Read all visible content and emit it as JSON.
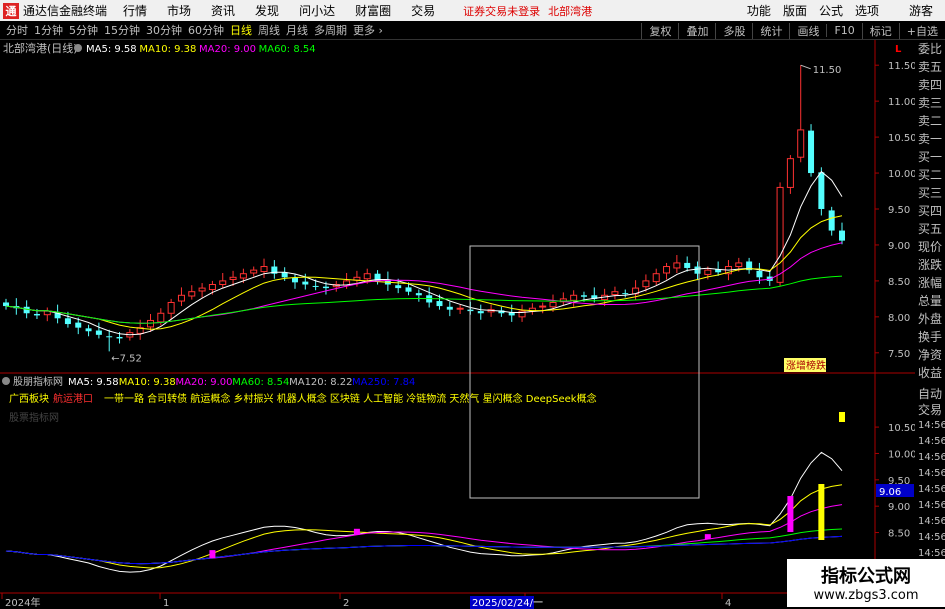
{
  "app": {
    "logo_glyph": "通",
    "title": "通达信金融终端",
    "menu": [
      "行情",
      "市场",
      "资讯",
      "发现",
      "问小达",
      "财富圈",
      "交易"
    ],
    "notice": "证券交易未登录",
    "notice_stock": "北部湾港",
    "right_menu": [
      "功能",
      "版面",
      "公式",
      "选项"
    ],
    "guest": "游客"
  },
  "periods": {
    "tabs": [
      "分时",
      "1分钟",
      "5分钟",
      "15分钟",
      "30分钟",
      "60分钟",
      "日线",
      "周线",
      "月线",
      "多周期",
      "更多"
    ],
    "active": "日线",
    "right_tools": [
      "复权",
      "叠加",
      "多股",
      "统计",
      "画线",
      "F10",
      "标记",
      "+自选"
    ]
  },
  "main_chart": {
    "stock_label": "北部湾港(日线)",
    "ma": [
      {
        "name": "MA5",
        "value": "9.58",
        "color": "#ffffff"
      },
      {
        "name": "MA10",
        "value": "9.38",
        "color": "#ffff00"
      },
      {
        "name": "MA20",
        "value": "9.00",
        "color": "#ff00ff"
      },
      {
        "name": "MA60",
        "value": "8.54",
        "color": "#00ff00"
      }
    ],
    "y_ticks": [
      "11.50",
      "11.00",
      "10.50",
      "10.00",
      "9.50",
      "9.00",
      "8.50",
      "8.00",
      "7.50"
    ],
    "ylim": [
      7.4,
      11.6
    ],
    "high_label": "11.50",
    "low_label": "7.52",
    "badge": "涨增榜跌",
    "corner_mark": "L"
  },
  "indicator": {
    "name": "股朋指标网",
    "ma": [
      {
        "name": "MA5",
        "value": "9.58",
        "color": "#ffffff"
      },
      {
        "name": "MA10",
        "value": "9.38",
        "color": "#ffff00"
      },
      {
        "name": "MA20",
        "value": "9.00",
        "color": "#ff00ff"
      },
      {
        "name": "MA60",
        "value": "8.54",
        "color": "#00ff00"
      },
      {
        "name": "MA120",
        "value": "8.22",
        "color": "#c0c0c0"
      },
      {
        "name": "MA250",
        "value": "7.84",
        "color": "#0000ff"
      }
    ],
    "sector_prefix": "广西板块",
    "sector_highlight": "航运港口",
    "concepts": "一带一路 合司转债 航运概念 乡村振兴 机器人概念 区块链 人工智能 冷链物流 天然气 星闪概念 DeepSeek概念",
    "subtitle": "股票指标网",
    "y_ticks": [
      "10.50",
      "10.00",
      "9.50",
      "9.00",
      "8.50"
    ],
    "current_tag": "9.06"
  },
  "x_axis": {
    "labels": [
      "2024年",
      "1",
      "2",
      "3",
      "4"
    ],
    "cursor_date": "2025/02/24/一"
  },
  "side_panel": {
    "top": [
      "委比",
      "卖五",
      "卖四",
      "卖三",
      "卖二",
      "卖一",
      "买一",
      "买二",
      "买三",
      "买四",
      "买五",
      "现价",
      "涨跌",
      "涨幅",
      "总量",
      "外盘",
      "换手",
      "净资",
      "收益"
    ],
    "bottom": [
      "自动",
      "交易",
      "14:56",
      "14:56",
      "14:56",
      "14:56",
      "14:56",
      "14:56",
      "14:56",
      "14:56",
      "14:56",
      "14:56"
    ]
  },
  "watermark": {
    "line1": "指标公式网",
    "line2": "www.zbgs3.com"
  },
  "chart_data": {
    "type": "candlestick",
    "closes": [
      8.15,
      8.12,
      8.05,
      8.02,
      8.08,
      7.98,
      7.9,
      7.85,
      7.8,
      7.75,
      7.72,
      7.7,
      7.78,
      7.85,
      7.95,
      8.05,
      8.2,
      8.3,
      8.35,
      8.4,
      8.45,
      8.5,
      8.55,
      8.6,
      8.65,
      8.7,
      8.6,
      8.55,
      8.48,
      8.45,
      8.42,
      8.4,
      8.45,
      8.5,
      8.55,
      8.6,
      8.5,
      8.45,
      8.4,
      8.35,
      8.3,
      8.2,
      8.15,
      8.1,
      8.12,
      8.08,
      8.05,
      8.1,
      8.05,
      8.02,
      8.08,
      8.12,
      8.15,
      8.2,
      8.25,
      8.3,
      8.28,
      8.25,
      8.3,
      8.35,
      8.32,
      8.4,
      8.5,
      8.6,
      8.7,
      8.75,
      8.68,
      8.6,
      8.65,
      8.62,
      8.7,
      8.75,
      8.65,
      8.55,
      8.5,
      9.8,
      10.2,
      10.6,
      10.0,
      9.5,
      9.2,
      9.06
    ]
  }
}
